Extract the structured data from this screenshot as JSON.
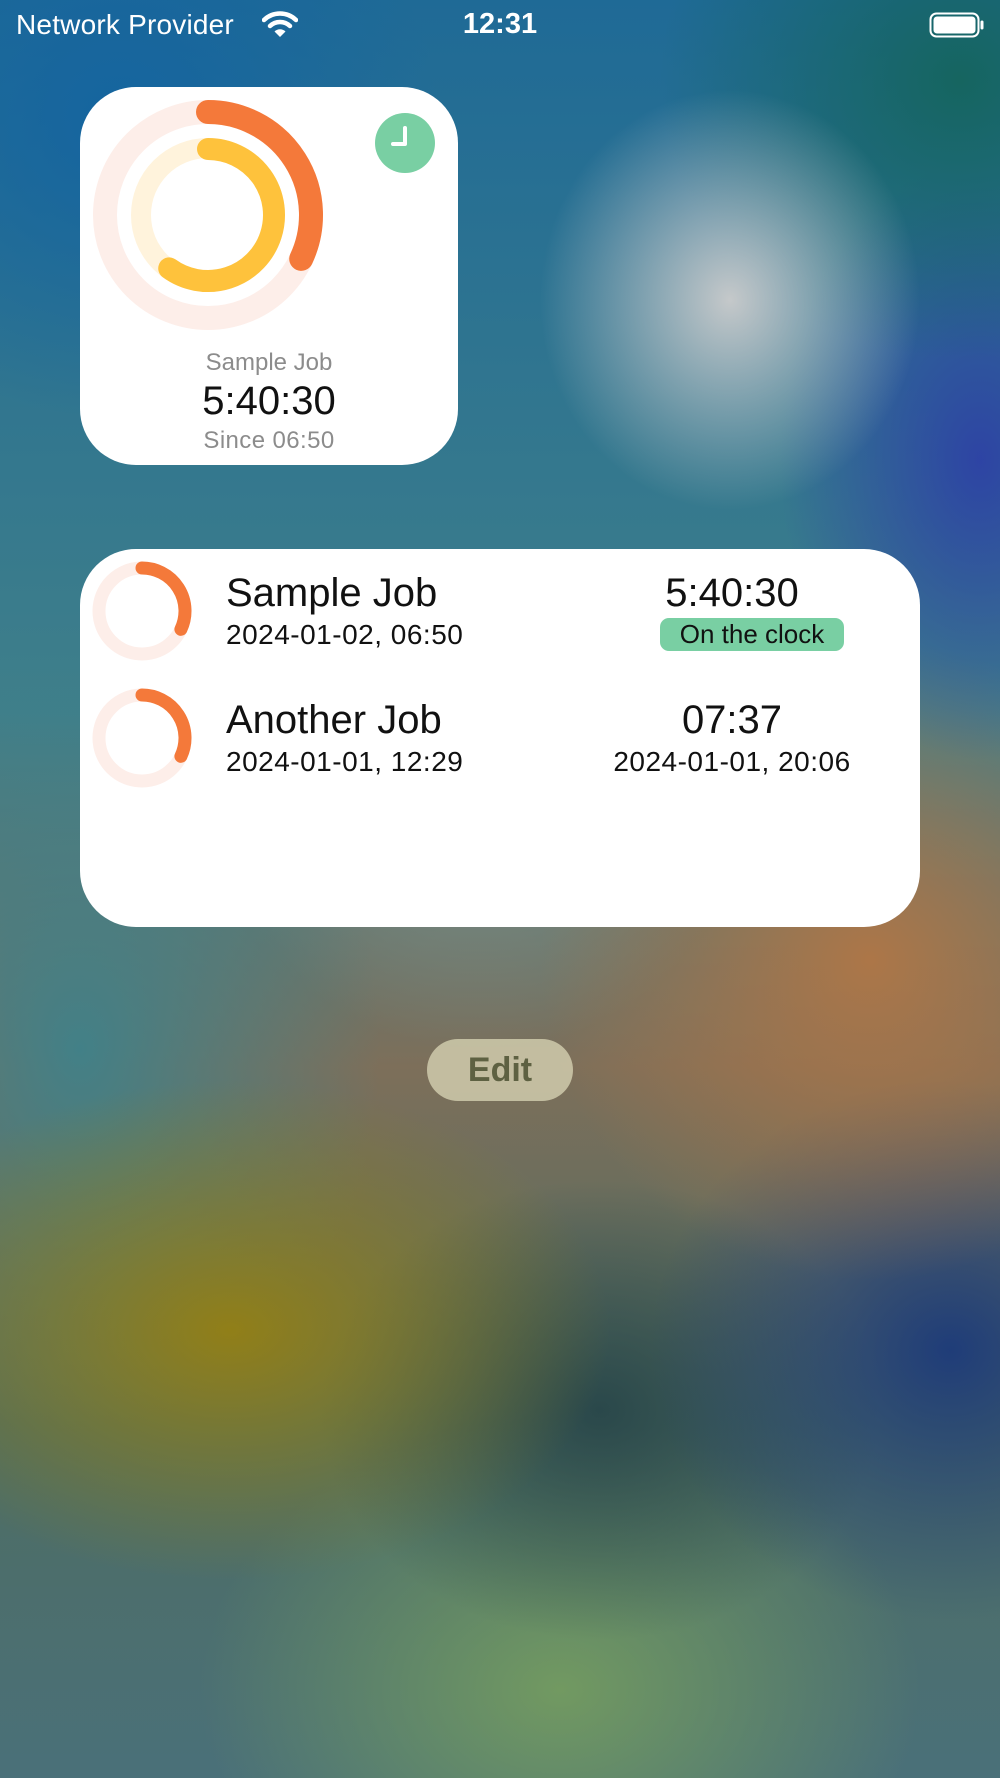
{
  "status_bar": {
    "carrier": "Network Provider",
    "time": "12:31",
    "wifi_icon": "wifi-icon",
    "battery_icon": "battery-icon"
  },
  "small_widget": {
    "job_name": "Sample Job",
    "elapsed": "5:40:30",
    "since_label": "Since 06:50",
    "badge_icon": "clock-icon",
    "outer_ring_progress": 0.32,
    "inner_ring_progress": 0.6
  },
  "medium_widget": {
    "jobs": [
      {
        "name": "Sample Job",
        "start": "2024-01-02, 06:50",
        "duration": "5:40:30",
        "status": "On the clock",
        "ring_progress": 0.32
      },
      {
        "name": "Another Job",
        "start": "2024-01-01, 12:29",
        "duration": "07:37",
        "end": "2024-01-01, 20:06",
        "ring_progress": 0.32
      }
    ]
  },
  "edit_button": {
    "label": "Edit"
  },
  "colors": {
    "accent_orange": "#f4793a",
    "accent_yellow": "#fec23c",
    "status_green": "#79cfa3",
    "ring_track": "#fdeee9"
  }
}
